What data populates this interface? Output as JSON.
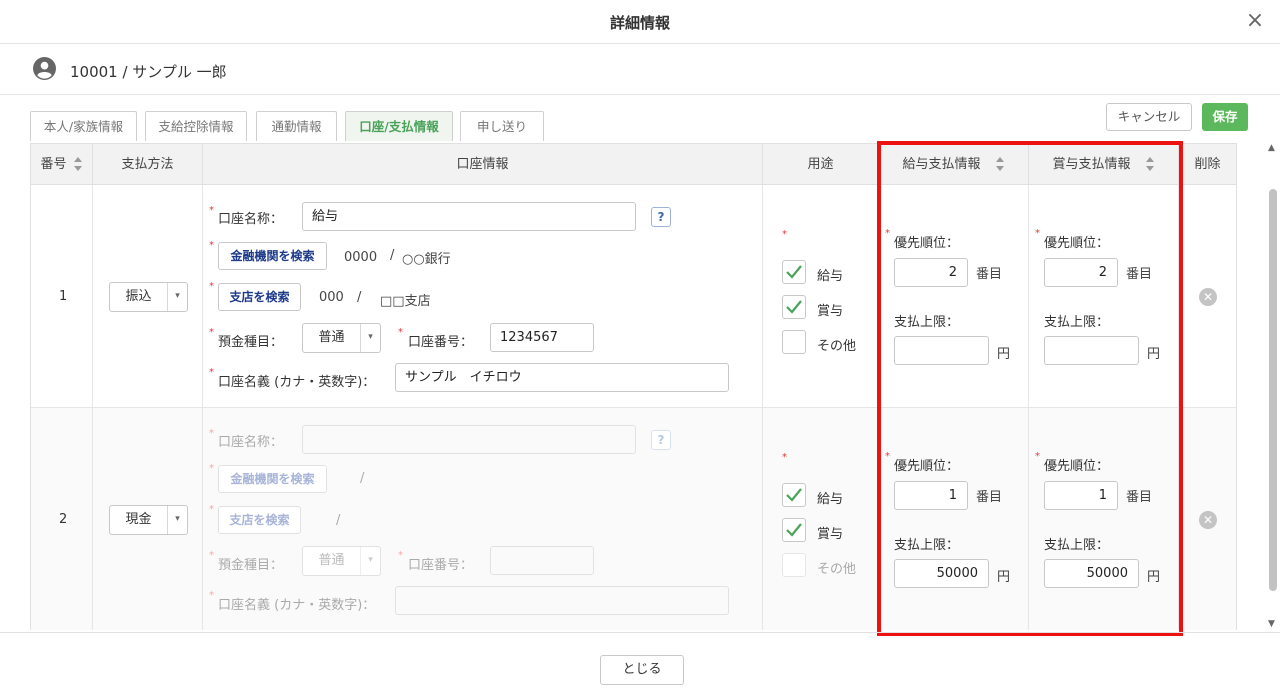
{
  "dialog": {
    "title": "詳細情報",
    "close_glyph": "×"
  },
  "employee": {
    "name": "10001 / サンプル 一郎"
  },
  "tabs": [
    {
      "label": "本人/家族情報"
    },
    {
      "label": "支給控除情報"
    },
    {
      "label": "通勤情報"
    },
    {
      "label": "口座/支払情報"
    },
    {
      "label": "申し送り"
    }
  ],
  "actions": {
    "cancel": "キャンセル",
    "save": "保存"
  },
  "columns": {
    "number": "番号",
    "method": "支払方法",
    "account": "口座情報",
    "usage": "用途",
    "salary": "給与支払情報",
    "bonus": "賞与支払情報",
    "delete": "削除"
  },
  "labels": {
    "account_name": "口座名称：",
    "bank_search": "金融機関を検索",
    "branch_search": "支店を検索",
    "deposit_type": "預金種目：",
    "account_no": "口座番号：",
    "holder": "口座名義 (カナ・英数字)：",
    "usage_salary": "給与",
    "usage_bonus": "賞与",
    "usage_other": "その他",
    "priority": "優先順位：",
    "priority_unit": "番目",
    "limit": "支払上限：",
    "yen": "円",
    "required": "*",
    "help": "?",
    "slash": "/",
    "check": "✓",
    "remove": "✕",
    "dropdown": "▾"
  },
  "rows": [
    {
      "no": "1",
      "method": "振込",
      "account_name": "給与",
      "bank_code": "0000",
      "bank_name": "○○銀行",
      "branch_code": "000",
      "branch_name": "□□支店",
      "deposit_type": "普通",
      "account_no": "1234567",
      "holder": "サンプル　イチロウ",
      "salary_priority": "2",
      "salary_limit": "",
      "bonus_priority": "2",
      "bonus_limit": ""
    },
    {
      "no": "2",
      "method": "現金",
      "account_name": "",
      "bank_code": "",
      "bank_name": "",
      "branch_code": "",
      "branch_name": "",
      "deposit_type": "普通",
      "account_no": "",
      "holder": "",
      "salary_priority": "1",
      "salary_limit": "50000",
      "bonus_priority": "1",
      "bonus_limit": "50000"
    }
  ],
  "footer": {
    "close": "とじる"
  },
  "colors": {
    "accent": "#5cb85c",
    "highlight": "#ee1111",
    "link": "#1d3a8a"
  }
}
